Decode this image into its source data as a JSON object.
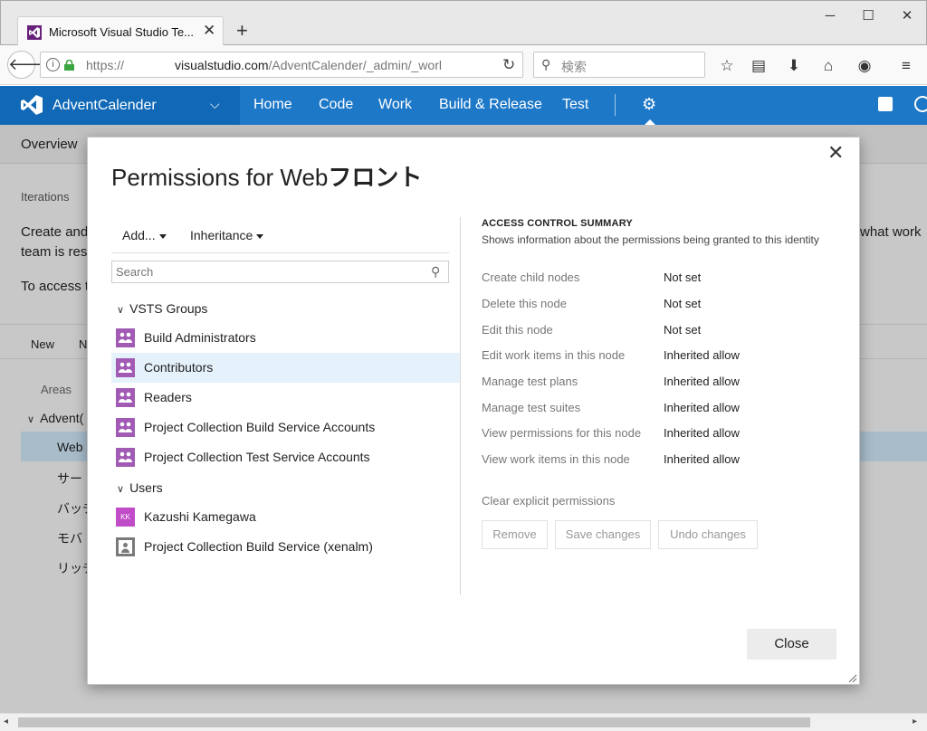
{
  "browser": {
    "tab_title": "Microsoft Visual Studio Te...",
    "tab_icon_letter": "",
    "url_prefix": "https://",
    "url_host": "visualstudio.com",
    "url_path": "/AdventCalender/_admin/_worl",
    "search_placeholder": "検索"
  },
  "vsts": {
    "project": "AdventCalender",
    "nav": [
      "Home",
      "Code",
      "Work",
      "Build & Release",
      "Test"
    ]
  },
  "background": {
    "subnav": "Overview",
    "section": "Iterations",
    "create_text": "Create and",
    "team_text": "team is res",
    "access_text": "To access t",
    "what_work": "what work",
    "new_btn": "New",
    "n_btn": "N",
    "areas_label": "Areas",
    "advent_item": "Advent(",
    "rows": [
      "Web",
      "サー",
      "バッチ",
      "モバ",
      "リッチ"
    ]
  },
  "dialog": {
    "title_prefix": "Permissions for Web",
    "title_suffix": "フロント",
    "add_label": "Add...",
    "inheritance_label": "Inheritance",
    "search_placeholder": "Search",
    "group_vsts": "VSTS Groups",
    "groups": [
      "Build Administrators",
      "Contributors",
      "Readers",
      "Project Collection Build Service Accounts",
      "Project Collection Test Service Accounts"
    ],
    "group_users": "Users",
    "user_kk_initials": "KK",
    "users": [
      "Kazushi Kamegawa",
      "Project Collection Build Service (xenalm)"
    ],
    "acs_title": "ACCESS CONTROL SUMMARY",
    "acs_sub": "Shows information about the permissions being granted to this identity",
    "permissions": [
      {
        "name": "Create child nodes",
        "value": "Not set"
      },
      {
        "name": "Delete this node",
        "value": "Not set"
      },
      {
        "name": "Edit this node",
        "value": "Not set"
      },
      {
        "name": "Edit work items in this node",
        "value": "Inherited allow"
      },
      {
        "name": "Manage test plans",
        "value": "Inherited allow"
      },
      {
        "name": "Manage test suites",
        "value": "Inherited allow"
      },
      {
        "name": "View permissions for this node",
        "value": "Inherited allow"
      },
      {
        "name": "View work items in this node",
        "value": "Inherited allow"
      }
    ],
    "clear_link": "Clear explicit permissions",
    "remove_btn": "Remove",
    "save_btn": "Save changes",
    "undo_btn": "Undo changes",
    "close_btn": "Close"
  },
  "colors": {
    "vsts_blue": "#1e78c8",
    "group_icon": "#a25bb5",
    "selection": "#e5f1fb"
  }
}
